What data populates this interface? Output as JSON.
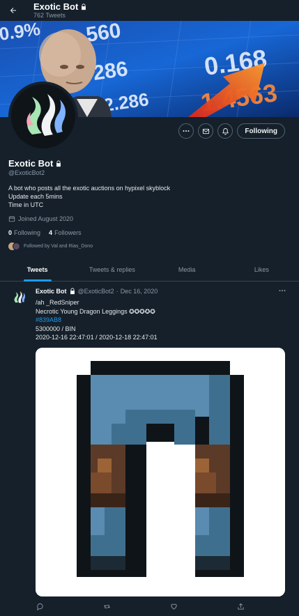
{
  "header": {
    "name": "Exotic Bot",
    "tweet_count": "762 Tweets"
  },
  "profile": {
    "name": "Exotic Bot",
    "handle": "@ExoticBot2",
    "bio": [
      "A bot who posts all the exotic auctions on hypixel skyblock",
      "Update each 5mins",
      "Time in UTC"
    ],
    "joined": "Joined August 2020",
    "following_count": "0",
    "following_label": "Following",
    "followers_count": "4",
    "followers_label": "Followers",
    "followed_by": "Followed by Val and Rias_Dono",
    "follow_button": "Following"
  },
  "banner": {
    "tickers": [
      "560",
      "0.9%",
      "286",
      "2.286",
      "0.168",
      "1.4563"
    ]
  },
  "tabs": [
    "Tweets",
    "Tweets & replies",
    "Media",
    "Likes"
  ],
  "tweet": {
    "name": "Exotic Bot",
    "handle": "@ExoticBot2",
    "separator": "·",
    "date": "Dec 16, 2020",
    "lines": [
      "/ah _RedSniper",
      "Necrotic Young Dragon Leggings ✪✪✪✪✪",
      "#839AB8",
      "5300000 / BIN",
      "2020-12-16 22:47:01 / 2020-12-18 22:47:01"
    ]
  },
  "colors": {
    "background": "#15202b",
    "accent": "#1d9bf0",
    "hashtag": "#1d9bf0",
    "muted_text": "#8b98a5"
  },
  "icons": {
    "back": "arrow-left-icon",
    "lock": "lock-icon",
    "more": "more-horizontal-icon",
    "mail": "envelope-icon",
    "notify": "bell-plus-icon",
    "calendar": "calendar-icon",
    "reply": "reply-icon",
    "retweet": "retweet-icon",
    "like": "heart-icon",
    "share": "share-icon"
  }
}
